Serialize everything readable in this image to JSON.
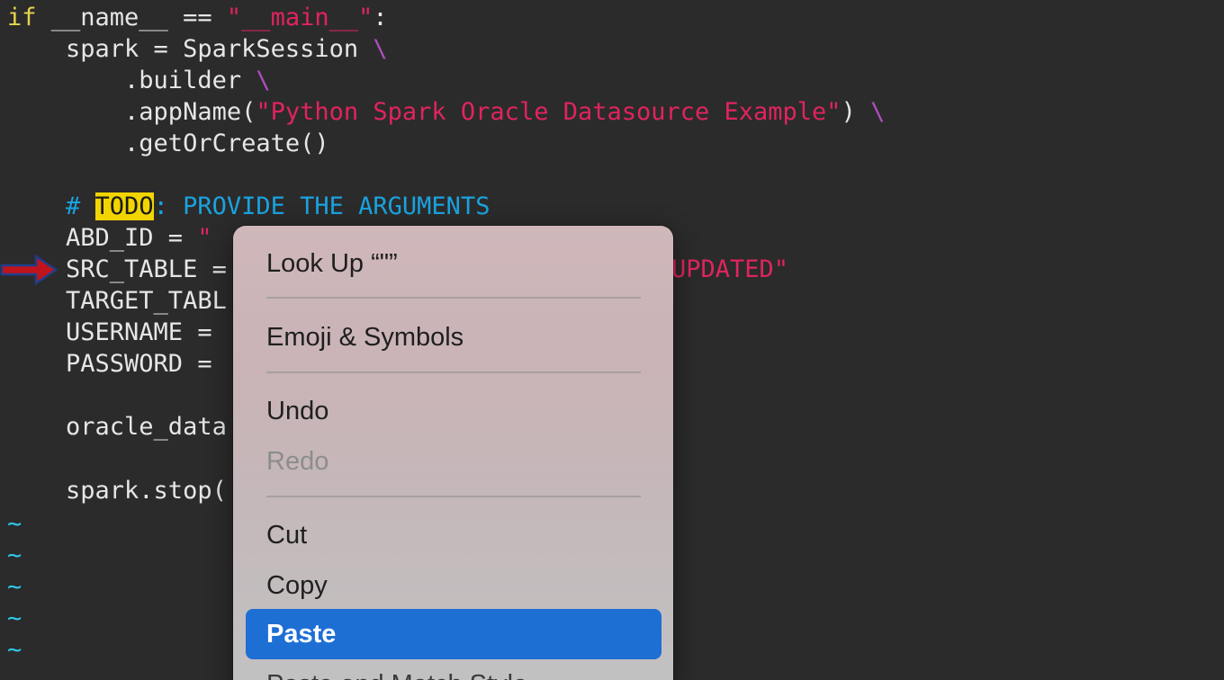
{
  "editor": {
    "line1": {
      "kw": "if",
      "a": " __name__ == ",
      "s": "\"__main__\"",
      "b": ":"
    },
    "line2": {
      "a": "    spark = SparkSession ",
      "c": "\\"
    },
    "line3": {
      "a": "        .builder ",
      "c": "\\"
    },
    "line4": {
      "a": "        .appName(",
      "s": "\"Python Spark Oracle Datasource Example\"",
      "b": ") ",
      "c": "\\"
    },
    "line5": {
      "a": "        .getOrCreate()"
    },
    "line7": {
      "hash": "    # ",
      "todo": "TODO",
      "rest": ": PROVIDE THE ARGUMENTS"
    },
    "line8": {
      "a": "    ABD_ID = ",
      "s": "\""
    },
    "line9": {
      "a": "    SRC_TABLE =",
      "s_tail": "UPDATED\""
    },
    "line10": {
      "a": "    TARGET_TABL"
    },
    "line11": {
      "a": "    USERNAME ="
    },
    "line12": {
      "a": "    PASSWORD ="
    },
    "line14": {
      "a": "    oracle_data"
    },
    "line16": {
      "a": "    spark.stop("
    },
    "tilde": "~"
  },
  "context_menu": {
    "look_up": "Look Up “\"”",
    "emoji": "Emoji & Symbols",
    "undo": "Undo",
    "redo": "Redo",
    "cut": "Cut",
    "copy": "Copy",
    "paste": "Paste",
    "paste_match": "Paste and Match Style"
  },
  "colors": {
    "editor_bg": "#2b2b2b",
    "keyword": "#e8d44d",
    "string": "#e0245e",
    "comment": "#1aa3e0",
    "todo_highlight": "#f2d500",
    "tilde": "#2ec8e8",
    "menu_selection": "#1e6fd4",
    "arrow": "#c0141c"
  },
  "icons": {
    "arrow": "right-arrow-icon"
  }
}
